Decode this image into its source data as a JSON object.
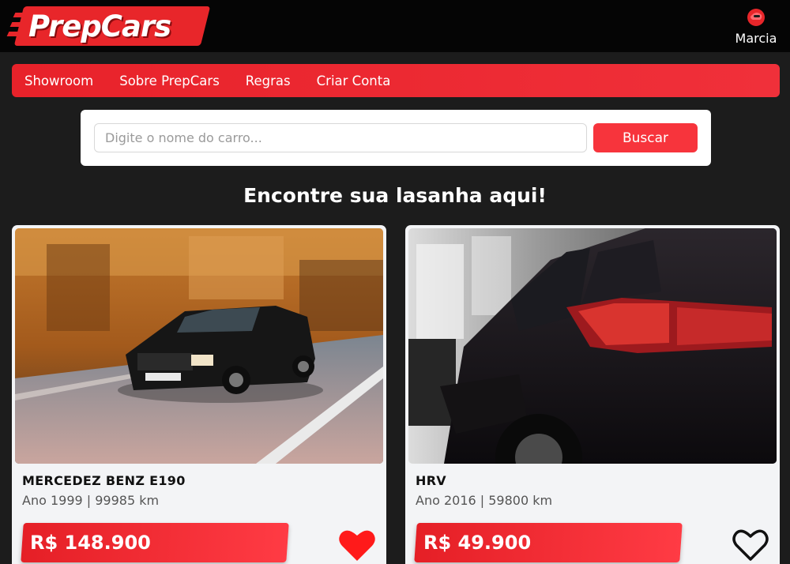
{
  "brand": {
    "name": "PrepCars"
  },
  "user": {
    "name": "Marcia",
    "icon": "user-avatar-icon"
  },
  "nav": {
    "items": [
      "Showroom",
      "Sobre PrepCars",
      "Regras",
      "Criar Conta"
    ]
  },
  "search": {
    "placeholder": "Digite o nome do carro...",
    "value": "",
    "button_label": "Buscar"
  },
  "heading": "Encontre sua lasanha aqui!",
  "cars": [
    {
      "title": "MERCEDEZ BENZ E190",
      "specs": "Ano 1999 | 99985 km",
      "price": "R$ 148.900",
      "favorite": true,
      "favorite_icon": "heart-filled-icon"
    },
    {
      "title": "HRV",
      "specs": "Ano 2016 | 59800 km",
      "price": "R$ 49.900",
      "favorite": false,
      "favorite_icon": "heart-outline-icon"
    }
  ],
  "colors": {
    "accent": "#e8262a",
    "background": "#1c1c1c",
    "header": "#050505",
    "card": "#f3f4f6"
  }
}
